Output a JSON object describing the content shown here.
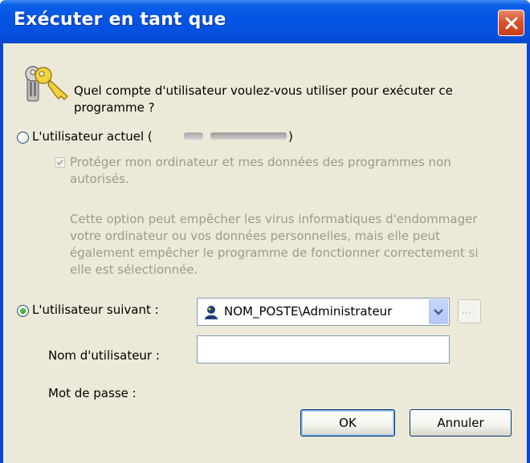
{
  "window": {
    "title": "Exécuter en tant que"
  },
  "prompt": {
    "line1": "Quel compte d'utilisateur voulez-vous utiliser pour exécuter ce",
    "line2": "programme ?"
  },
  "current_user": {
    "label": "L'utilisateur actuel (",
    "label_end": ")",
    "selected": false,
    "protect_checkbox": {
      "checked": true,
      "line1": "Protéger mon ordinateur et mes données des programmes non",
      "line2": "autorisés."
    },
    "warning_lines": [
      "Cette option peut empêcher les virus informatiques d'endommager",
      "votre ordinateur ou vos données personnelles, mais elle peut",
      "également empêcher le programme de fonctionner correctement si",
      "elle est sélectionnée."
    ]
  },
  "following_user": {
    "label": "L'utilisateur suivant :",
    "selected": true,
    "username_label": "Nom d'utilisateur :",
    "username_value": "NOM_POSTE\\Administrateur",
    "browse_label": "...",
    "password_label": "Mot de passe :",
    "password_value": ""
  },
  "buttons": {
    "ok": "OK",
    "cancel": "Annuler"
  },
  "colors": {
    "title_bar": "#0554e3",
    "dialog_bg": "#ece9d8",
    "close_button": "#d9532c",
    "radio_selected": "#21a121",
    "disabled_text": "#9c9a8c"
  }
}
